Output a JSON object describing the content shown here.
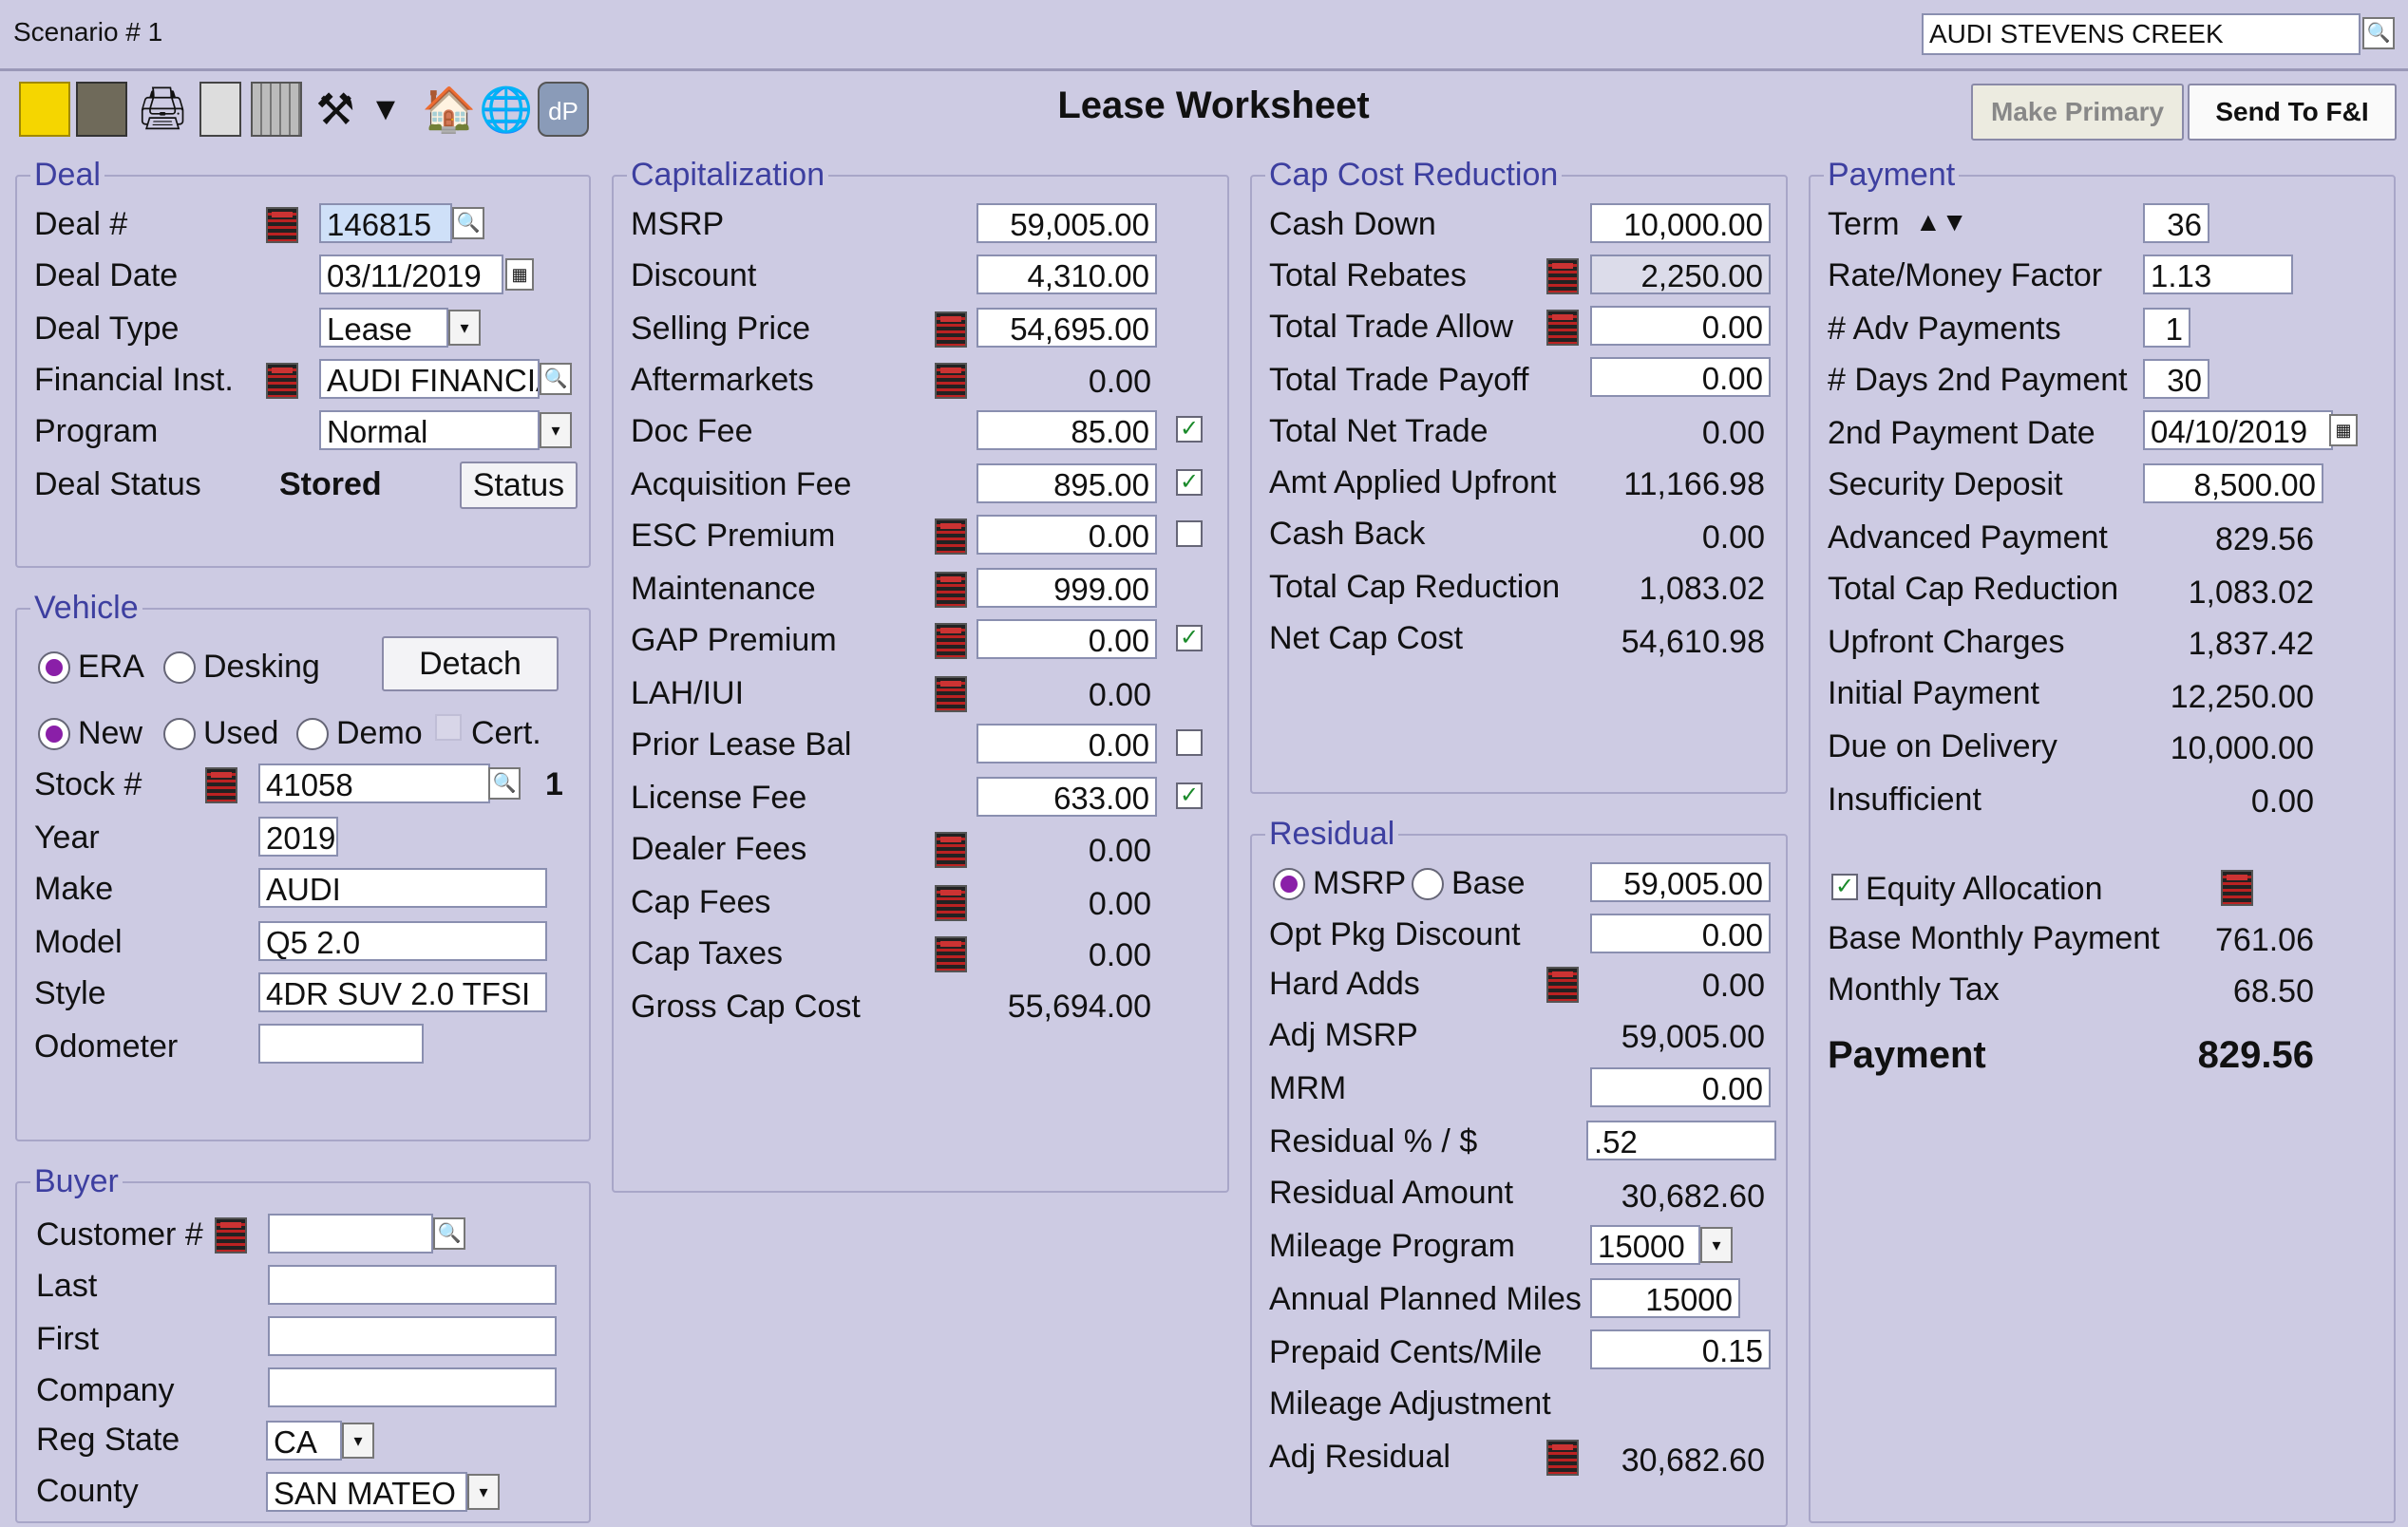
{
  "window": {
    "scenario": "Scenario # 1",
    "dealer": "AUDI STEVENS CREEK"
  },
  "header": {
    "title": "Lease Worksheet",
    "make_primary": "Make Primary",
    "send_fi": "Send To F&I"
  },
  "toolbar": {
    "icons": [
      "notes-icon",
      "document-icon",
      "print-icon",
      "clipboard-icon",
      "calculator-icon",
      "hammer-icon",
      "dropdown-arrow-icon",
      "home-icon",
      "globe-icon",
      "dp-icon"
    ]
  },
  "deal": {
    "legend": "Deal",
    "deal_no_label": "Deal #",
    "deal_no": "146815",
    "deal_date_label": "Deal Date",
    "deal_date": "03/11/2019",
    "deal_type_label": "Deal Type",
    "deal_type": "Lease",
    "fin_inst_label": "Financial Inst.",
    "fin_inst": "AUDI FINANCIA",
    "program_label": "Program",
    "program": "Normal",
    "status_label": "Deal Status",
    "status": "Stored",
    "status_button": "Status"
  },
  "vehicle": {
    "legend": "Vehicle",
    "era": "ERA",
    "desking": "Desking",
    "detach": "Detach",
    "new": "New",
    "used": "Used",
    "demo": "Demo",
    "cert": "Cert.",
    "stock_label": "Stock #",
    "stock": "41058",
    "stock_count": "1",
    "year_label": "Year",
    "year": "2019",
    "make_label": "Make",
    "make": "AUDI",
    "model_label": "Model",
    "model": "Q5 2.0",
    "style_label": "Style",
    "style": "4DR SUV 2.0 TFSI",
    "odometer_label": "Odometer",
    "odometer": ""
  },
  "buyer": {
    "legend": "Buyer",
    "customer_label": "Customer #",
    "customer": "",
    "last_label": "Last",
    "last": "",
    "first_label": "First",
    "first": "",
    "company_label": "Company",
    "company": "",
    "reg_state_label": "Reg State",
    "reg_state": "CA",
    "county_label": "County",
    "county": "SAN MATEO"
  },
  "cap": {
    "legend": "Capitalization",
    "msrp_label": "MSRP",
    "msrp": "59,005.00",
    "discount_label": "Discount",
    "discount": "4,310.00",
    "selling_label": "Selling Price",
    "selling": "54,695.00",
    "after_label": "Aftermarkets",
    "after": "0.00",
    "doc_label": "Doc Fee",
    "doc": "85.00",
    "acq_label": "Acquisition Fee",
    "acq": "895.00",
    "esc_label": "ESC Premium",
    "esc": "0.00",
    "maint_label": "Maintenance",
    "maint": "999.00",
    "gap_label": "GAP Premium",
    "gap": "0.00",
    "lah_label": "LAH/IUI",
    "lah": "0.00",
    "prior_label": "Prior Lease Bal",
    "prior": "0.00",
    "license_label": "License Fee",
    "license": "633.00",
    "dealer_label": "Dealer Fees",
    "dealer": "0.00",
    "capfees_label": "Cap Fees",
    "capfees": "0.00",
    "captax_label": "Cap Taxes",
    "captax": "0.00",
    "gross_label": "Gross Cap Cost",
    "gross": "55,694.00"
  },
  "ccr": {
    "legend": "Cap Cost Reduction",
    "cash_label": "Cash Down",
    "cash": "10,000.00",
    "rebates_label": "Total Rebates",
    "rebates": "2,250.00",
    "trade_allow_label": "Total Trade Allow",
    "trade_allow": "0.00",
    "trade_payoff_label": "Total Trade Payoff",
    "trade_payoff": "0.00",
    "net_trade_label": "Total Net Trade",
    "net_trade": "0.00",
    "applied_label": "Amt Applied Upfront",
    "applied": "11,166.98",
    "cashback_label": "Cash Back",
    "cashback": "0.00",
    "total_label": "Total Cap Reduction",
    "total": "1,083.02",
    "net_label": "Net Cap Cost",
    "net": "54,610.98"
  },
  "residual": {
    "legend": "Residual",
    "msrp": "MSRP",
    "base": "Base",
    "basis": "59,005.00",
    "opt_label": "Opt Pkg Discount",
    "opt": "0.00",
    "hard_label": "Hard Adds",
    "hard": "0.00",
    "adj_msrp_label": "Adj MSRP",
    "adj_msrp": "59,005.00",
    "mrm_label": "MRM",
    "mrm": "0.00",
    "pct_label": "Residual % / $",
    "pct": ".52",
    "amount_label": "Residual Amount",
    "amount": "30,682.60",
    "mileage_label": "Mileage Program",
    "mileage": "15000",
    "annual_label": "Annual Planned Miles",
    "annual": "15000",
    "prepaid_label": "Prepaid Cents/Mile",
    "prepaid": "0.15",
    "madj_label": "Mileage Adjustment",
    "adj_label": "Adj Residual",
    "adj": "30,682.60"
  },
  "payment": {
    "legend": "Payment",
    "term_label": "Term",
    "term": "36",
    "rate_label": "Rate/Money Factor",
    "rate": "1.13",
    "adv_label": "# Adv Payments",
    "adv": "1",
    "days_label": "# Days 2nd Payment",
    "days": "30",
    "date2_label": "2nd Payment Date",
    "date2": "04/10/2019",
    "sec_label": "Security Deposit",
    "sec": "8,500.00",
    "advpay_label": "Advanced Payment",
    "advpay": "829.56",
    "tcr_label": "Total Cap Reduction",
    "tcr": "1,083.02",
    "upfront_label": "Upfront Charges",
    "upfront": "1,837.42",
    "initial_label": "Initial Payment",
    "initial": "12,250.00",
    "due_label": "Due on Delivery",
    "due": "10,000.00",
    "insuf_label": "Insufficient",
    "insuf": "0.00",
    "equity_label": "Equity Allocation",
    "base_label": "Base Monthly Payment",
    "base": "761.06",
    "tax_label": "Monthly Tax",
    "tax": "68.50",
    "pay_label": "Payment",
    "pay": "829.56"
  }
}
